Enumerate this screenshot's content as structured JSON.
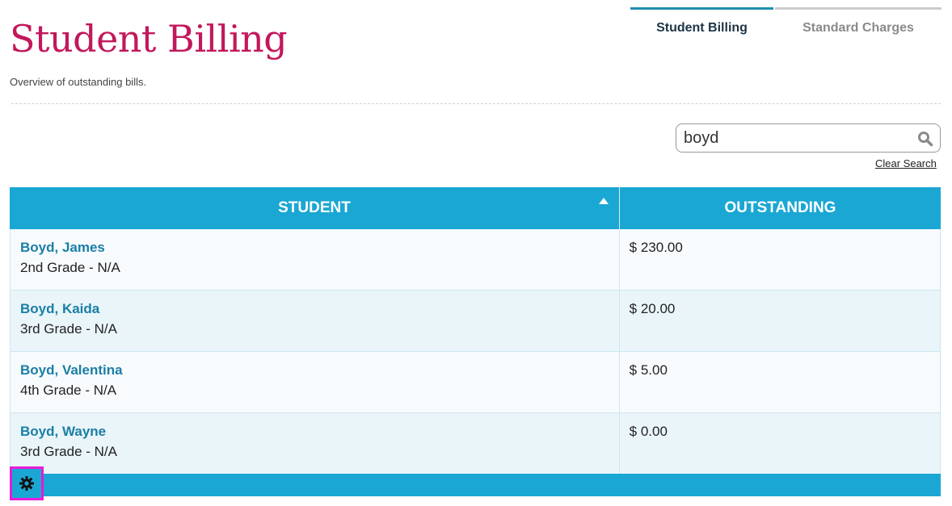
{
  "header": {
    "title": "Student Billing",
    "subtitle": "Overview of outstanding bills."
  },
  "tabs": [
    {
      "label": "Student Billing",
      "active": true
    },
    {
      "label": "Standard Charges",
      "active": false
    }
  ],
  "search": {
    "value": "boyd",
    "clear_label": "Clear Search",
    "icon": "search-icon"
  },
  "table": {
    "columns": [
      "STUDENT",
      "OUTSTANDING"
    ],
    "sort": {
      "column": "STUDENT",
      "direction": "ascending"
    },
    "rows": [
      {
        "name": "Boyd, James",
        "grade": "2nd Grade - N/A",
        "outstanding": "$ 230.00"
      },
      {
        "name": "Boyd, Kaida",
        "grade": "3rd Grade - N/A",
        "outstanding": "$ 20.00"
      },
      {
        "name": "Boyd, Valentina",
        "grade": "4th Grade - N/A",
        "outstanding": "$ 5.00"
      },
      {
        "name": "Boyd, Wayne",
        "grade": "3rd Grade - N/A",
        "outstanding": "$ 0.00"
      }
    ]
  },
  "footer": {
    "settings_icon": "gear-icon"
  },
  "colors": {
    "title": "#c2185b",
    "header_bar": "#1aa7d4",
    "link": "#1a7ea6",
    "active_tab_border": "#1f8fb0",
    "highlight_border": "#e81ad8"
  }
}
